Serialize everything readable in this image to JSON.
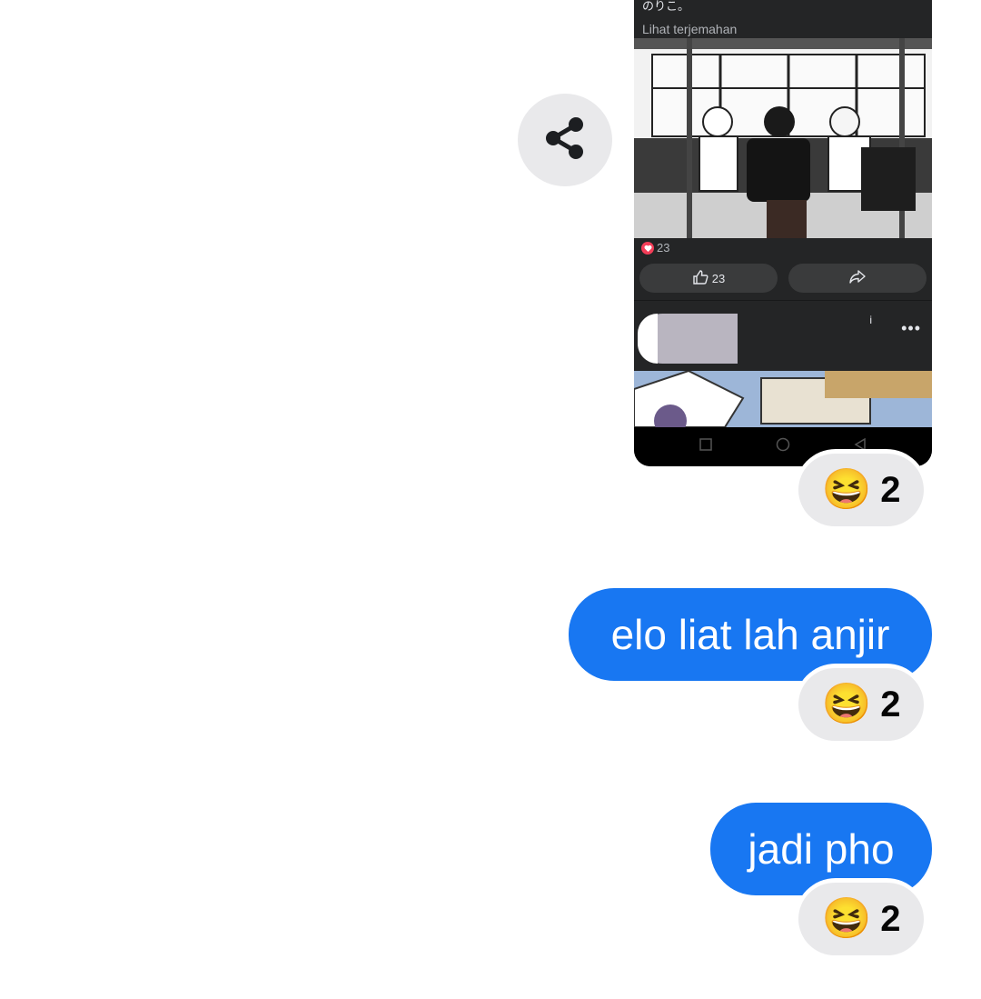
{
  "share_button": {
    "icon": "share-icon"
  },
  "shared_screenshot": {
    "japanese_text": "のりこ。",
    "translate_link": "Lihat terjemahan",
    "reaction_count": "23",
    "like_count": "23",
    "like_icon": "thumbs-up-icon",
    "share_icon": "share-arrow-icon",
    "more_icon": "•••",
    "tiny_mark": "i"
  },
  "messages": [
    {
      "reaction_emoji": "😆",
      "reaction_count": "2"
    },
    {
      "text": "elo liat lah anjir",
      "reaction_emoji": "😆",
      "reaction_count": "2"
    },
    {
      "text": "jadi pho",
      "reaction_emoji": "😆",
      "reaction_count": "2"
    }
  ],
  "colors": {
    "bubble": "#1877f2",
    "pill": "#e9e9eb",
    "share_bg": "#e9e9eb",
    "dark_ui": "#242526"
  }
}
